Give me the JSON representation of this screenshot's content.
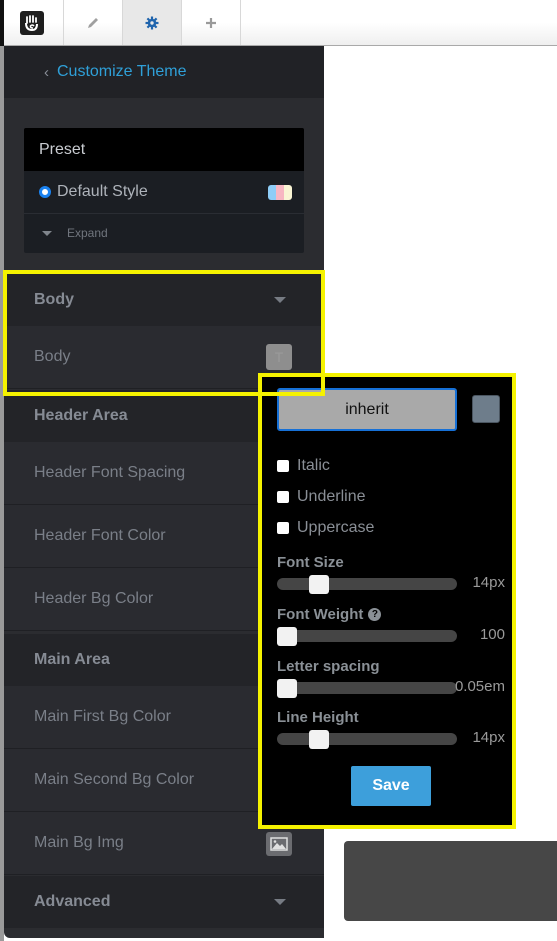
{
  "toolbar": {
    "logo": "concrete-hand-logo",
    "tools": [
      {
        "name": "edit",
        "icon": "pencil-icon",
        "active": false
      },
      {
        "name": "settings",
        "icon": "gear-icon",
        "active": true
      },
      {
        "name": "add",
        "icon": "plus-icon",
        "active": false
      }
    ]
  },
  "sidebar": {
    "back_icon": "‹",
    "title": "Customize Theme",
    "preset": {
      "title": "Preset",
      "selected_style": "Default Style",
      "swatch_colors": [
        "#8ecdf7",
        "#f7b6c2",
        "#f9f4d4"
      ],
      "expand_label": "Expand"
    },
    "sections": [
      {
        "title": "Body",
        "collapsible": true,
        "items": [
          {
            "label": "Body",
            "control": "font-swatch",
            "swatch_glyph": "T"
          }
        ]
      },
      {
        "title": "Header Area",
        "collapsible": false,
        "items": [
          {
            "label": "Header Font Spacing"
          },
          {
            "label": "Header Font Color"
          },
          {
            "label": "Header Bg Color"
          }
        ]
      },
      {
        "title": "Main Area",
        "collapsible": false,
        "items": [
          {
            "label": "Main First Bg Color"
          },
          {
            "label": "Main Second Bg Color"
          },
          {
            "label": "Main Bg Img",
            "control": "image-icon"
          }
        ]
      },
      {
        "title": "Advanced",
        "collapsible": true,
        "items": []
      }
    ]
  },
  "popup": {
    "font_family_value": "inherit",
    "color_value": "#6e7d8b",
    "checkboxes": [
      {
        "label": "Italic",
        "checked": false
      },
      {
        "label": "Underline",
        "checked": false
      },
      {
        "label": "Uppercase",
        "checked": false
      }
    ],
    "sliders": [
      {
        "label": "Font Size",
        "value_text": "14px",
        "position": 0.2,
        "help": false
      },
      {
        "label": "Font Weight",
        "value_text": "100",
        "position": 0.0,
        "help": true
      },
      {
        "label": "Letter spacing",
        "value_text": "0.05em",
        "position": 0.0,
        "help": false
      },
      {
        "label": "Line Height",
        "value_text": "14px",
        "position": 0.2,
        "help": false
      }
    ],
    "help_glyph": "?",
    "save_label": "Save"
  },
  "colors": {
    "accent": "#2fa0d8",
    "save_button": "#3d9fdb",
    "highlight": "#f5f200",
    "sidebar_bg": "#2b2c30"
  }
}
